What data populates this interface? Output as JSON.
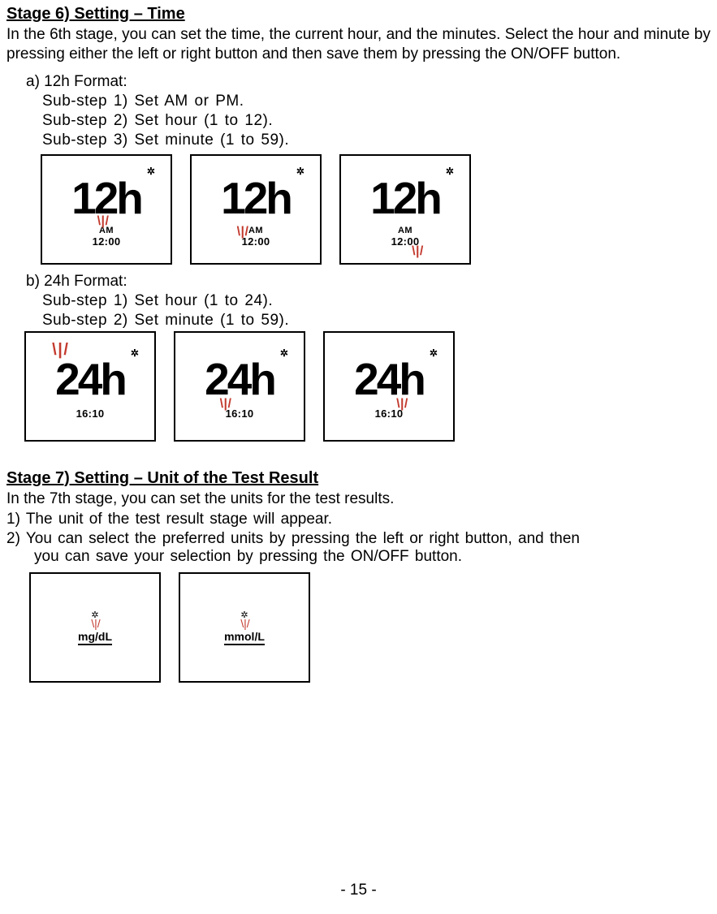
{
  "stage6": {
    "heading": "Stage 6) Setting – Time",
    "intro": "In the 6th stage, you can set the time, the current hour, and the minutes. Select the hour and minute by pressing either the left or right button and then save them by pressing the ON/OFF button.",
    "a": {
      "label": "a) 12h Format:",
      "steps": [
        "Sub-step 1) Set AM or PM.",
        "Sub-step 2) Set hour (1 to 12).",
        "Sub-step 3) Set minute (1 to 59)."
      ],
      "lcd_main": "12h",
      "lcd_ampm": "AM",
      "lcd_time": "12:00",
      "highlight_marks": "\\ | /"
    },
    "b": {
      "label": "b) 24h Format:",
      "steps": [
        "Sub-step 1) Set hour (1 to 24).",
        "Sub-step 2) Set minute (1 to 59)."
      ],
      "lcd_main": "24h",
      "lcd_time": "16:10",
      "highlight_marks": "\\ | /"
    }
  },
  "stage7": {
    "heading": "Stage 7) Setting – Unit of the Test Result",
    "intro": "In the 7th stage, you can set the units for the test results.",
    "steps_line1": "1) The unit of the test result stage will appear.",
    "steps_line2a": "2) You can select the preferred units by pressing the left or right button, and then",
    "steps_line2b": "you can save your selection by pressing the ON/OFF button.",
    "units": {
      "marks": "\\ | /",
      "label1": "mg/dL",
      "label2": "mmol/L"
    }
  },
  "page_number": "- 15 -",
  "glyphs": {
    "dot_icon": "✲"
  }
}
